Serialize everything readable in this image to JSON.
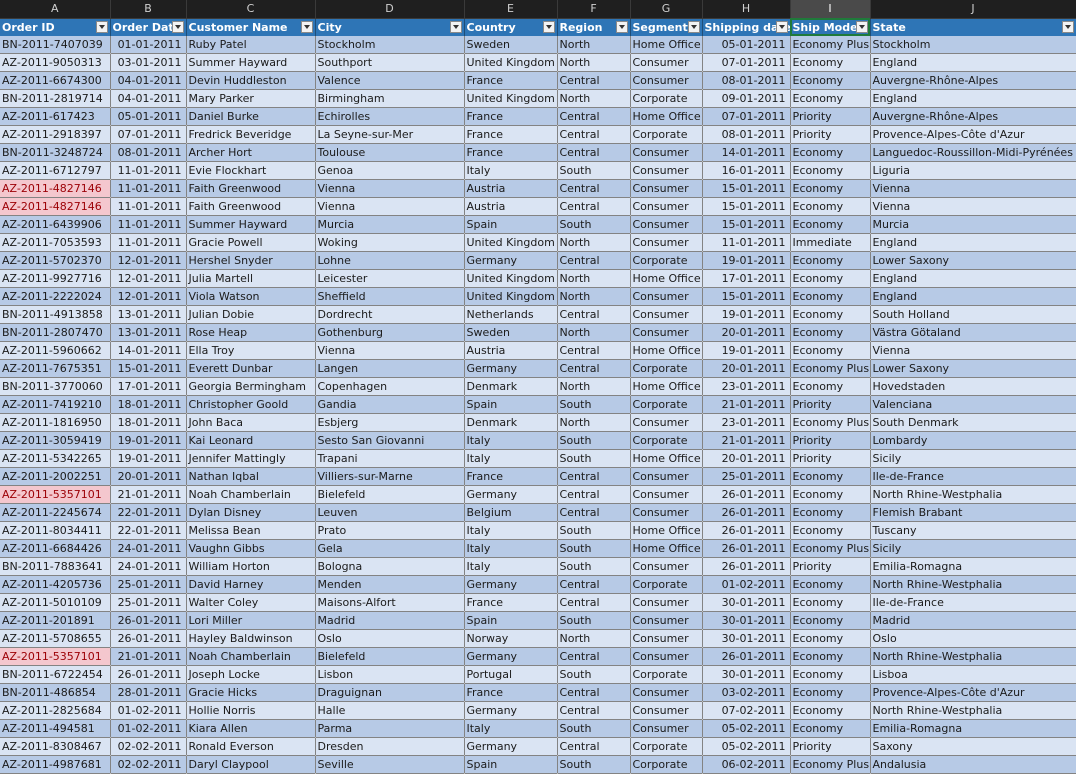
{
  "column_letters": [
    "A",
    "B",
    "C",
    "D",
    "E",
    "F",
    "G",
    "H",
    "I",
    "J"
  ],
  "active_column": "I",
  "headers": [
    "Order ID",
    "Order Date",
    "Customer Name",
    "City",
    "Country",
    "Region",
    "Segment",
    "Shipping date",
    "Ship Mode",
    "State"
  ],
  "colors": {
    "header_fill": "#2e75b6",
    "band_dark": "#b7cae6",
    "band_light": "#dae4f3",
    "duplicate_fill": "#f4c7ce",
    "duplicate_text": "#9c0006"
  },
  "rows": [
    [
      "BN-2011-7407039",
      "01-01-2011",
      "Ruby Patel",
      "Stockholm",
      "Sweden",
      "North",
      "Home Office",
      "05-01-2011",
      "Economy Plus",
      "Stockholm"
    ],
    [
      "AZ-2011-9050313",
      "03-01-2011",
      "Summer Hayward",
      "Southport",
      "United Kingdom",
      "North",
      "Consumer",
      "07-01-2011",
      "Economy",
      "England"
    ],
    [
      "AZ-2011-6674300",
      "04-01-2011",
      "Devin Huddleston",
      "Valence",
      "France",
      "Central",
      "Consumer",
      "08-01-2011",
      "Economy",
      "Auvergne-Rhône-Alpes"
    ],
    [
      "BN-2011-2819714",
      "04-01-2011",
      "Mary Parker",
      "Birmingham",
      "United Kingdom",
      "North",
      "Corporate",
      "09-01-2011",
      "Economy",
      "England"
    ],
    [
      "AZ-2011-617423",
      "05-01-2011",
      "Daniel Burke",
      "Echirolles",
      "France",
      "Central",
      "Home Office",
      "07-01-2011",
      "Priority",
      "Auvergne-Rhône-Alpes"
    ],
    [
      "AZ-2011-2918397",
      "07-01-2011",
      "Fredrick Beveridge",
      "La Seyne-sur-Mer",
      "France",
      "Central",
      "Corporate",
      "08-01-2011",
      "Priority",
      "Provence-Alpes-Côte d'Azur"
    ],
    [
      "BN-2011-3248724",
      "08-01-2011",
      "Archer Hort",
      "Toulouse",
      "France",
      "Central",
      "Consumer",
      "14-01-2011",
      "Economy",
      "Languedoc-Roussillon-Midi-Pyrénées"
    ],
    [
      "AZ-2011-6712797",
      "11-01-2011",
      "Evie Flockhart",
      "Genoa",
      "Italy",
      "South",
      "Consumer",
      "16-01-2011",
      "Economy",
      "Liguria"
    ],
    [
      "AZ-2011-4827146",
      "11-01-2011",
      "Faith Greenwood",
      "Vienna",
      "Austria",
      "Central",
      "Consumer",
      "15-01-2011",
      "Economy",
      "Vienna"
    ],
    [
      "AZ-2011-4827146",
      "11-01-2011",
      "Faith Greenwood",
      "Vienna",
      "Austria",
      "Central",
      "Consumer",
      "15-01-2011",
      "Economy",
      "Vienna"
    ],
    [
      "AZ-2011-6439906",
      "11-01-2011",
      "Summer Hayward",
      "Murcia",
      "Spain",
      "South",
      "Consumer",
      "15-01-2011",
      "Economy",
      "Murcia"
    ],
    [
      "AZ-2011-7053593",
      "11-01-2011",
      "Gracie Powell",
      "Woking",
      "United Kingdom",
      "North",
      "Consumer",
      "11-01-2011",
      "Immediate",
      "England"
    ],
    [
      "AZ-2011-5702370",
      "12-01-2011",
      "Hershel Snyder",
      "Lohne",
      "Germany",
      "Central",
      "Corporate",
      "19-01-2011",
      "Economy",
      "Lower Saxony"
    ],
    [
      "AZ-2011-9927716",
      "12-01-2011",
      "Julia Martell",
      "Leicester",
      "United Kingdom",
      "North",
      "Home Office",
      "17-01-2011",
      "Economy",
      "England"
    ],
    [
      "AZ-2011-2222024",
      "12-01-2011",
      "Viola Watson",
      "Sheffield",
      "United Kingdom",
      "North",
      "Consumer",
      "15-01-2011",
      "Economy",
      "England"
    ],
    [
      "BN-2011-4913858",
      "13-01-2011",
      "Julian Dobie",
      "Dordrecht",
      "Netherlands",
      "Central",
      "Consumer",
      "19-01-2011",
      "Economy",
      "South Holland"
    ],
    [
      "BN-2011-2807470",
      "13-01-2011",
      "Rose Heap",
      "Gothenburg",
      "Sweden",
      "North",
      "Consumer",
      "20-01-2011",
      "Economy",
      "Västra Götaland"
    ],
    [
      "AZ-2011-5960662",
      "14-01-2011",
      "Ella Troy",
      "Vienna",
      "Austria",
      "Central",
      "Home Office",
      "19-01-2011",
      "Economy",
      "Vienna"
    ],
    [
      "AZ-2011-7675351",
      "15-01-2011",
      "Everett Dunbar",
      "Langen",
      "Germany",
      "Central",
      "Corporate",
      "20-01-2011",
      "Economy Plus",
      "Lower Saxony"
    ],
    [
      "BN-2011-3770060",
      "17-01-2011",
      "Georgia Bermingham",
      "Copenhagen",
      "Denmark",
      "North",
      "Home Office",
      "23-01-2011",
      "Economy",
      "Hovedstaden"
    ],
    [
      "AZ-2011-7419210",
      "18-01-2011",
      "Christopher Goold",
      "Gandia",
      "Spain",
      "South",
      "Corporate",
      "21-01-2011",
      "Priority",
      "Valenciana"
    ],
    [
      "AZ-2011-1816950",
      "18-01-2011",
      "John Baca",
      "Esbjerg",
      "Denmark",
      "North",
      "Consumer",
      "23-01-2011",
      "Economy Plus",
      "South Denmark"
    ],
    [
      "AZ-2011-3059419",
      "19-01-2011",
      "Kai Leonard",
      "Sesto San Giovanni",
      "Italy",
      "South",
      "Corporate",
      "21-01-2011",
      "Priority",
      "Lombardy"
    ],
    [
      "AZ-2011-5342265",
      "19-01-2011",
      "Jennifer Mattingly",
      "Trapani",
      "Italy",
      "South",
      "Home Office",
      "20-01-2011",
      "Priority",
      "Sicily"
    ],
    [
      "AZ-2011-2002251",
      "20-01-2011",
      "Nathan Iqbal",
      "Villiers-sur-Marne",
      "France",
      "Central",
      "Consumer",
      "25-01-2011",
      "Economy",
      "Ile-de-France"
    ],
    [
      "AZ-2011-5357101",
      "21-01-2011",
      "Noah Chamberlain",
      "Bielefeld",
      "Germany",
      "Central",
      "Consumer",
      "26-01-2011",
      "Economy",
      "North Rhine-Westphalia"
    ],
    [
      "AZ-2011-2245674",
      "22-01-2011",
      "Dylan Disney",
      "Leuven",
      "Belgium",
      "Central",
      "Consumer",
      "26-01-2011",
      "Economy",
      "Flemish Brabant"
    ],
    [
      "AZ-2011-8034411",
      "22-01-2011",
      "Melissa Bean",
      "Prato",
      "Italy",
      "South",
      "Home Office",
      "26-01-2011",
      "Economy",
      "Tuscany"
    ],
    [
      "AZ-2011-6684426",
      "24-01-2011",
      "Vaughn Gibbs",
      "Gela",
      "Italy",
      "South",
      "Home Office",
      "26-01-2011",
      "Economy Plus",
      "Sicily"
    ],
    [
      "BN-2011-7883641",
      "24-01-2011",
      "William Horton",
      "Bologna",
      "Italy",
      "South",
      "Consumer",
      "26-01-2011",
      "Priority",
      "Emilia-Romagna"
    ],
    [
      "AZ-2011-4205736",
      "25-01-2011",
      "David Harney",
      "Menden",
      "Germany",
      "Central",
      "Corporate",
      "01-02-2011",
      "Economy",
      "North Rhine-Westphalia"
    ],
    [
      "AZ-2011-5010109",
      "25-01-2011",
      "Walter Coley",
      "Maisons-Alfort",
      "France",
      "Central",
      "Consumer",
      "30-01-2011",
      "Economy",
      "Ile-de-France"
    ],
    [
      "AZ-2011-201891",
      "26-01-2011",
      "Lori Miller",
      "Madrid",
      "Spain",
      "South",
      "Consumer",
      "30-01-2011",
      "Economy",
      "Madrid"
    ],
    [
      "AZ-2011-5708655",
      "26-01-2011",
      "Hayley Baldwinson",
      "Oslo",
      "Norway",
      "North",
      "Consumer",
      "30-01-2011",
      "Economy",
      "Oslo"
    ],
    [
      "AZ-2011-5357101",
      "21-01-2011",
      "Noah Chamberlain",
      "Bielefeld",
      "Germany",
      "Central",
      "Consumer",
      "26-01-2011",
      "Economy",
      "North Rhine-Westphalia"
    ],
    [
      "BN-2011-6722454",
      "26-01-2011",
      "Joseph Locke",
      "Lisbon",
      "Portugal",
      "South",
      "Corporate",
      "30-01-2011",
      "Economy",
      "Lisboa"
    ],
    [
      "BN-2011-486854",
      "28-01-2011",
      "Gracie Hicks",
      "Draguignan",
      "France",
      "Central",
      "Consumer",
      "03-02-2011",
      "Economy",
      "Provence-Alpes-Côte d'Azur"
    ],
    [
      "AZ-2011-2825684",
      "01-02-2011",
      "Hollie Norris",
      "Halle",
      "Germany",
      "Central",
      "Consumer",
      "07-02-2011",
      "Economy",
      "North Rhine-Westphalia"
    ],
    [
      "AZ-2011-494581",
      "01-02-2011",
      "Kiara Allen",
      "Parma",
      "Italy",
      "South",
      "Consumer",
      "05-02-2011",
      "Economy",
      "Emilia-Romagna"
    ],
    [
      "AZ-2011-8308467",
      "02-02-2011",
      "Ronald Everson",
      "Dresden",
      "Germany",
      "Central",
      "Corporate",
      "05-02-2011",
      "Priority",
      "Saxony"
    ],
    [
      "AZ-2011-4987681",
      "02-02-2011",
      "Daryl Claypool",
      "Seville",
      "Spain",
      "South",
      "Corporate",
      "06-02-2011",
      "Economy Plus",
      "Andalusia"
    ]
  ],
  "duplicate_rows": [
    8,
    9,
    25,
    34
  ]
}
